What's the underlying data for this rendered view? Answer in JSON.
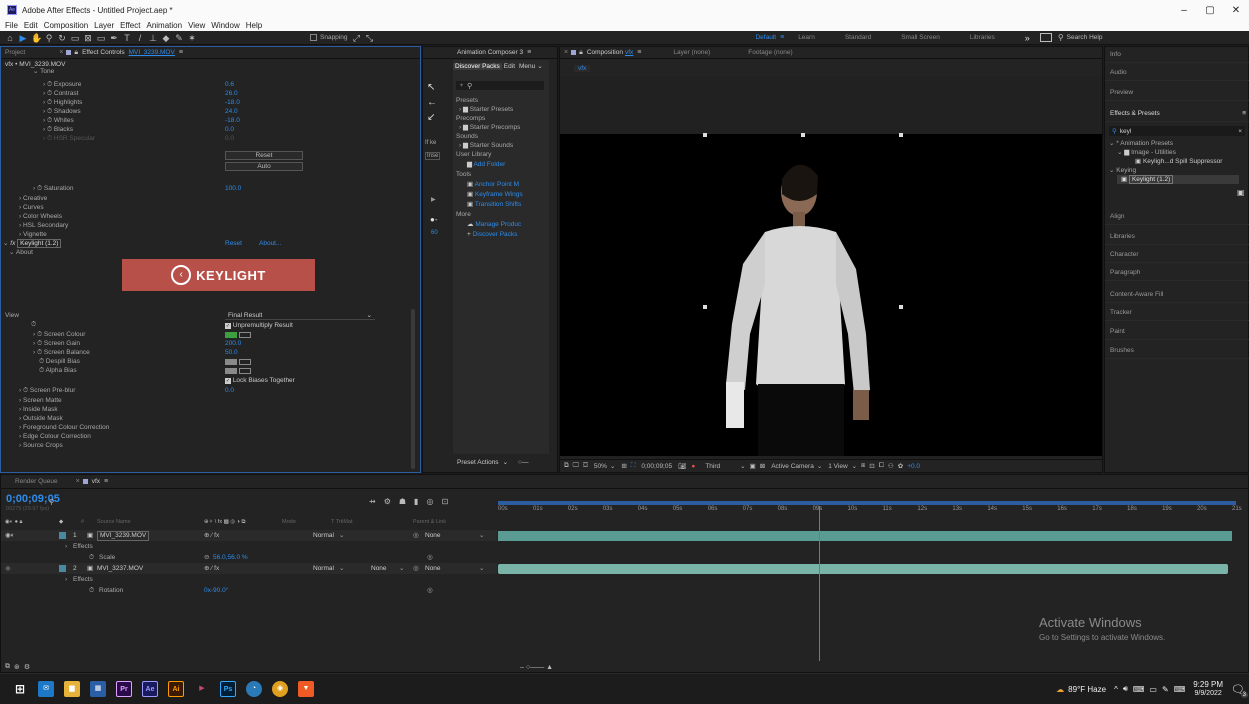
{
  "window": {
    "title": "Adobe After Effects - Untitled Project.aep *"
  },
  "menu": [
    "File",
    "Edit",
    "Composition",
    "Layer",
    "Effect",
    "Animation",
    "View",
    "Window",
    "Help"
  ],
  "toolbar": {
    "snapping": "Snapping"
  },
  "workspace": {
    "tabs": [
      "Default",
      "Learn",
      "Standard",
      "Small Screen",
      "Libraries"
    ],
    "search": "Search Help"
  },
  "project_panel": {
    "tab_project": "Project",
    "tab_effect_controls": "Effect Controls",
    "ec_target": "MVI_3239.MOV",
    "comp_path": "vfx • MVI_3239.MOV",
    "tone": "Tone",
    "tone_props": [
      {
        "name": "Exposure",
        "value": "0.6"
      },
      {
        "name": "Contrast",
        "value": "26.0"
      },
      {
        "name": "Highlights",
        "value": "-18.0"
      },
      {
        "name": "Shadows",
        "value": "24.0"
      },
      {
        "name": "Whites",
        "value": "-18.0"
      },
      {
        "name": "Blacks",
        "value": "0.0"
      },
      {
        "name": "HSR Specular",
        "value": "0.0"
      }
    ],
    "reset_btn": "Reset",
    "auto_btn": "Auto",
    "saturation": {
      "name": "Saturation",
      "value": "100.0"
    },
    "groups": [
      "Creative",
      "Curves",
      "Color Wheels",
      "HSL Secondary",
      "Vignette"
    ],
    "keylight": {
      "name": "Keylight (1.2)",
      "reset": "Reset",
      "about": "About..."
    },
    "about": "About",
    "logo_text": "KEYLIGHT",
    "view": {
      "label": "View",
      "value": "Final Result"
    },
    "unpremultiply": "Unpremultiply Result",
    "screen_colour": "Screen Colour",
    "screen_gain": {
      "name": "Screen Gain",
      "value": "200.0"
    },
    "screen_balance": {
      "name": "Screen Balance",
      "value": "50.0"
    },
    "despill_bias": "Despill Bias",
    "alpha_bias": "Alpha Bias",
    "lock_biases": "Lock Biases Together",
    "screen_preblur": {
      "name": "Screen Pre-blur",
      "value": "0.0"
    },
    "tail_groups": [
      "Screen Matte",
      "Inside Mask",
      "Outside Mask",
      "Foreground Colour Correction",
      "Edge Colour Correction",
      "Source Crops"
    ]
  },
  "ac_panel": {
    "tab": "Animation Composer 3",
    "subtabs": [
      "Discover Packs",
      "Edit",
      "Menu"
    ],
    "search_icon": "search-icon",
    "sections": [
      {
        "title": "Presets",
        "items": [
          "Starter Presets"
        ]
      },
      {
        "title": "Precomps",
        "items": [
          "Starter Precomps"
        ]
      },
      {
        "title": "Sounds",
        "items": [
          "Starter Sounds"
        ]
      },
      {
        "title": "User Library",
        "items": [
          "Add Folder"
        ]
      },
      {
        "title": "Tools",
        "items": [
          "Anchor Point M",
          "Keyframe Wings",
          "Transition Shifts"
        ]
      },
      {
        "title": "More",
        "items": [
          "Manage Produc",
          "Discover Packs"
        ]
      }
    ],
    "preset_actions": "Preset Actions",
    "left_labels": [
      "If ke",
      "Inse",
      "60"
    ]
  },
  "comp_panel": {
    "tab_comp": "Composition",
    "comp_name": "vfx",
    "tab_layer": "Layer (none)",
    "tab_footage": "Footage (none)",
    "flow_tab": "vfx",
    "zoom": "50%",
    "timecode": "0;00;09;05",
    "resolution": "Third",
    "camera": "Active Camera",
    "views": "1 View",
    "exposure": "+0.0"
  },
  "right_panels": {
    "top": [
      "Info",
      "Audio",
      "Preview"
    ],
    "effects_presets": "Effects & Presets",
    "search_value": "keyl",
    "tree": [
      "* Animation Presets",
      "Image - Utilities",
      "Keyligh...d Spill Suppressor",
      "Keying",
      "Keylight (1.2)"
    ],
    "bottom": [
      "Align",
      "Libraries",
      "Character",
      "Paragraph",
      "Content-Aware Fill",
      "Tracker",
      "Paint",
      "Brushes"
    ]
  },
  "timeline": {
    "render_queue": "Render Queue",
    "comp_tab": "vfx",
    "timecode": "0;00;09;05",
    "fps": "00275 (29.97 fps)",
    "columns": [
      "Source Name",
      "Mode",
      "T  TrkMat",
      "Parent & Link"
    ],
    "layers": [
      {
        "num": "1",
        "name": "MVI_3239.MOV",
        "mode": "Normal",
        "trkmat": "",
        "parent": "None",
        "sub": "Effects",
        "prop": "Scale",
        "propval": "56.0,56.0 %"
      },
      {
        "num": "2",
        "name": "MVI_3237.MOV",
        "mode": "Normal",
        "trkmat": "None",
        "parent": "None",
        "sub": "Effects",
        "prop": "Rotation",
        "propval": "0x-90.0°"
      }
    ],
    "ruler": [
      "00s",
      "01s",
      "02s",
      "03s",
      "04s",
      "05s",
      "06s",
      "07s",
      "08s",
      "09s",
      "10s",
      "11s",
      "12s",
      "13s",
      "14s",
      "15s",
      "16s",
      "17s",
      "18s",
      "19s",
      "20s",
      "21s"
    ],
    "current_time_fraction": 0.4375
  },
  "watermark": {
    "title": "Activate Windows",
    "sub": "Go to Settings to activate Windows."
  },
  "taskbar": {
    "weather": "89°F  Haze",
    "time": "9:29 PM",
    "date": "9/9/2022",
    "notif_count": "3"
  }
}
